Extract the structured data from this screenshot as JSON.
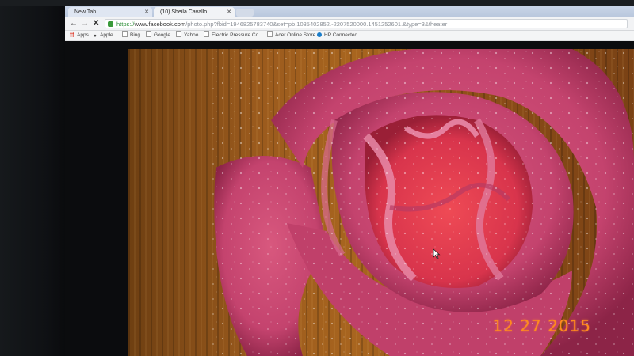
{
  "tabs": [
    {
      "label": "New Tab"
    },
    {
      "label": "(10) Sheila Cavallo"
    }
  ],
  "toolbar": {
    "url_scheme": "https://",
    "url_host": "www.facebook.com",
    "url_path": "/photo.php?fbid=1946825783740&set=pb.1035402852.-2207520000.1451252601.&type=3&theater"
  },
  "bookmarks": [
    {
      "label": "Apps",
      "icon": "apps-grid-icon"
    },
    {
      "label": "Apple",
      "icon": "apple-icon"
    },
    {
      "label": "Bing",
      "icon": "page-icon"
    },
    {
      "label": "Google",
      "icon": "page-icon"
    },
    {
      "label": "Yahoo",
      "icon": "page-icon"
    },
    {
      "label": "Electric Pressure Co...",
      "icon": "page-icon"
    },
    {
      "label": "Acer Online Store",
      "icon": "page-icon"
    },
    {
      "label": "HP Connected",
      "icon": "hp-icon"
    }
  ],
  "photo": {
    "subject": "rose",
    "date_stamp": "12 27 2015"
  },
  "colors": {
    "rose_petal": "#c4436e",
    "rose_center": "#d8344c",
    "background_wood": "#9a5a1d",
    "date_stamp": "#ff8a1e"
  }
}
